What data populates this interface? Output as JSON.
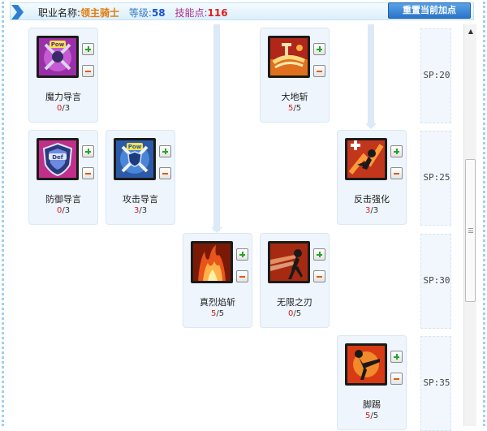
{
  "header": {
    "job_label": "职业名称:",
    "job_name": "领主骑士",
    "level_label": "等级:",
    "level": "58",
    "skill_points_label": "技能点:",
    "skill_points": "116",
    "reset_button": "重置当前加点"
  },
  "sp_tiers": [
    "SP:20",
    "SP:25",
    "SP:30",
    "SP:35"
  ],
  "skills": [
    {
      "name": "魔力导言",
      "current": "0",
      "max": "3",
      "icon": "pow-swords-icon"
    },
    {
      "name": "大地斩",
      "current": "5",
      "max": "5",
      "icon": "earth-slash-icon"
    },
    {
      "name": "防御导言",
      "current": "0",
      "max": "3",
      "icon": "def-shield-icon"
    },
    {
      "name": "攻击导言",
      "current": "3",
      "max": "3",
      "icon": "pow-shield-icon"
    },
    {
      "name": "反击强化",
      "current": "3",
      "max": "3",
      "icon": "counter-strike-icon"
    },
    {
      "name": "真烈焰斩",
      "current": "5",
      "max": "5",
      "icon": "flame-slash-icon"
    },
    {
      "name": "无限之刃",
      "current": "0",
      "max": "5",
      "icon": "infinite-blade-icon"
    },
    {
      "name": "脚踢",
      "current": "5",
      "max": "5",
      "icon": "kick-icon"
    }
  ],
  "colors": {
    "accent": "#2c74c8",
    "job": "#e07b0a",
    "level": "#1a4fd6",
    "skill_points": "#e21c1c",
    "card_bg": "#eef5fc"
  }
}
